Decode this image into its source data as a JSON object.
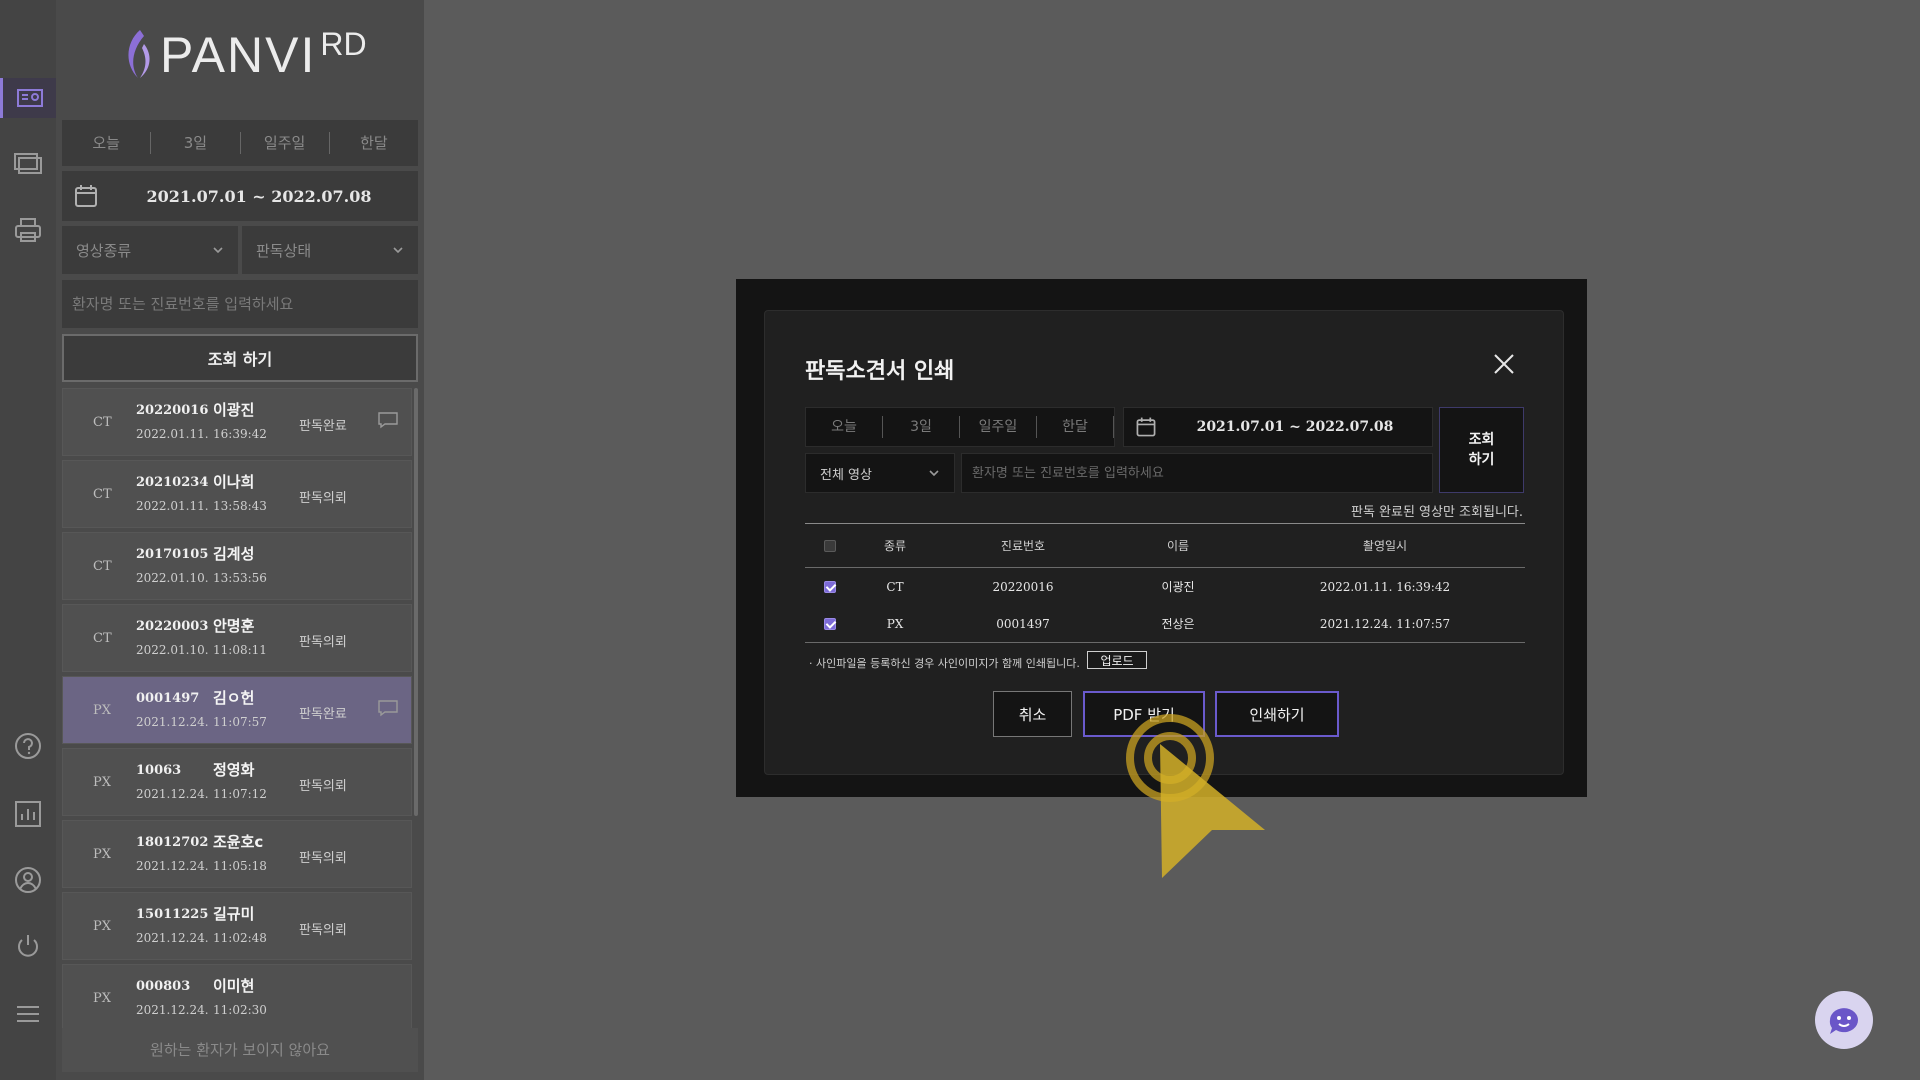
{
  "logo": {
    "text": "PANVI",
    "sup": "RD"
  },
  "rail": [
    "report-list-icon",
    "images-icon",
    "print-icon",
    "help-icon",
    "chart-icon",
    "user-icon",
    "power-icon",
    "menu-icon"
  ],
  "filters": {
    "periods": [
      "오늘",
      "3일",
      "일주일",
      "한달"
    ],
    "date_range": "2021.07.01 ~ 2022.07.08",
    "image_type": "영상종류",
    "read_status": "판독상태",
    "search_placeholder": "환자명 또는 진료번호를 입력하세요",
    "search_button": "조회 하기"
  },
  "patients": [
    {
      "type": "CT",
      "id": "20220016",
      "name": "이광진",
      "date": "2022.01.11.",
      "time": "16:39:42",
      "status": "판독완료",
      "has_msg": true,
      "selected": false
    },
    {
      "type": "CT",
      "id": "20210234",
      "name": "이나희",
      "date": "2022.01.11.",
      "time": "13:58:43",
      "status": "판독의뢰",
      "has_msg": false,
      "selected": false
    },
    {
      "type": "CT",
      "id": "20170105",
      "name": "김계성",
      "date": "2022.01.10.",
      "time": "13:53:56",
      "status": "",
      "has_msg": false,
      "selected": false
    },
    {
      "type": "CT",
      "id": "20220003",
      "name": "안명훈",
      "date": "2022.01.10.",
      "time": "11:08:11",
      "status": "판독의뢰",
      "has_msg": false,
      "selected": false
    },
    {
      "type": "PX",
      "id": "0001497",
      "name": "김ㅇ헌",
      "date": "2021.12.24.",
      "time": "11:07:57",
      "status": "판독완료",
      "has_msg": true,
      "selected": true
    },
    {
      "type": "PX",
      "id": "10063",
      "name": "정영화",
      "date": "2021.12.24.",
      "time": "11:07:12",
      "status": "판독의뢰",
      "has_msg": false,
      "selected": false
    },
    {
      "type": "PX",
      "id": "18012702",
      "name": "조윤호c",
      "date": "2021.12.24.",
      "time": "11:05:18",
      "status": "판독의뢰",
      "has_msg": false,
      "selected": false
    },
    {
      "type": "PX",
      "id": "15011225",
      "name": "길규미",
      "date": "2021.12.24.",
      "time": "11:02:48",
      "status": "판독의뢰",
      "has_msg": false,
      "selected": false
    },
    {
      "type": "PX",
      "id": "000803",
      "name": "이미현",
      "date": "2021.12.24.",
      "time": "11:02:30",
      "status": "",
      "has_msg": false,
      "selected": false
    }
  ],
  "not_visible": "원하는 환자가 보이지 않아요",
  "modal": {
    "title": "판독소견서 인쇄",
    "periods": [
      "오늘",
      "3일",
      "일주일",
      "한달"
    ],
    "date_range": "2021.07.01 ~ 2022.07.08",
    "search_button": "조회\n하기",
    "image_select": "전체 영상",
    "search_placeholder": "환자명 또는 진료번호를 입력하세요",
    "note": "판독 완료된 영상만 조회됩니다.",
    "table": {
      "headers": [
        "종류",
        "진료번호",
        "이름",
        "촬영일시"
      ],
      "rows": [
        {
          "checked": true,
          "type": "CT",
          "id": "20220016",
          "name": "이광진",
          "datetime": "2022.01.11. 16:39:42"
        },
        {
          "checked": true,
          "type": "PX",
          "id": "0001497",
          "name": "전상은",
          "datetime": "2021.12.24. 11:07:57"
        }
      ]
    },
    "sign_note": "· 사인파일을 등록하신 경우 사인이미지가 함께 인쇄됩니다.",
    "upload": "업로드",
    "cancel": "취소",
    "pdf": "PDF 받기",
    "print": "인쇄하기"
  },
  "colors": {
    "accent": "#6a5acd",
    "selected_row": "#6b6584"
  }
}
